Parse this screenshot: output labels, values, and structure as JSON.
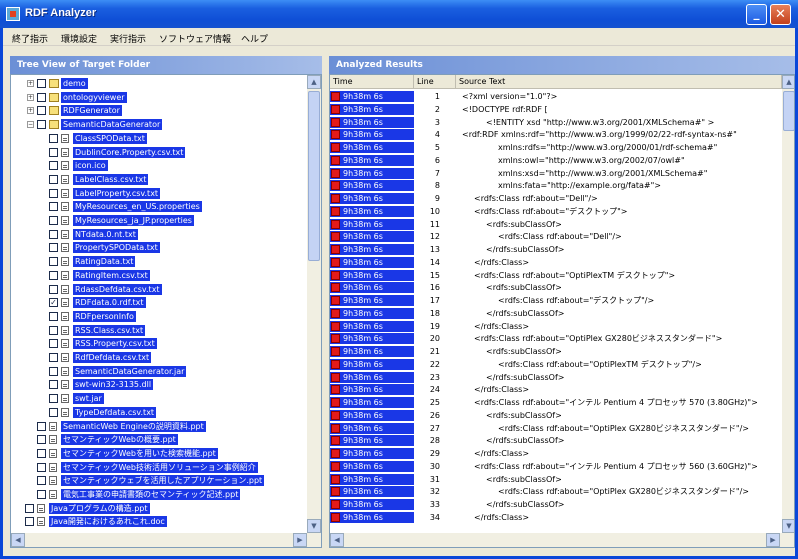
{
  "window": {
    "title": "RDF Analyzer",
    "minimize_label": "_",
    "close_label": "✕"
  },
  "menu": [
    {
      "label": "終了指示"
    },
    {
      "label": "環境設定"
    },
    {
      "label": "実行指示"
    },
    {
      "label": "ソフトウェア情報"
    },
    {
      "label": "ヘルプ"
    }
  ],
  "tree_panel": {
    "title": "Tree View of Target Folder",
    "items": [
      {
        "label": "demo",
        "depth": 2,
        "kind": "folder",
        "expanded": false,
        "checked": false
      },
      {
        "label": "ontologyviewer",
        "depth": 2,
        "kind": "folder",
        "expanded": false,
        "checked": false
      },
      {
        "label": "RDFGenerator",
        "depth": 2,
        "kind": "folder",
        "expanded": false,
        "checked": false
      },
      {
        "label": "SemanticDataGenerator",
        "depth": 2,
        "kind": "folder",
        "expanded": true,
        "checked": false
      },
      {
        "label": "ClassSPOData.txt",
        "depth": 3,
        "kind": "file",
        "checked": false
      },
      {
        "label": "DublinCore.Property.csv.txt",
        "depth": 3,
        "kind": "file",
        "checked": false
      },
      {
        "label": "icon.ico",
        "depth": 3,
        "kind": "file",
        "checked": false
      },
      {
        "label": "LabelClass.csv.txt",
        "depth": 3,
        "kind": "file",
        "checked": false
      },
      {
        "label": "LabelProperty.csv.txt",
        "depth": 3,
        "kind": "file",
        "checked": false
      },
      {
        "label": "MyResources_en_US.properties",
        "depth": 3,
        "kind": "file",
        "checked": false
      },
      {
        "label": "MyResources_ja_JP.properties",
        "depth": 3,
        "kind": "file",
        "checked": false
      },
      {
        "label": "NTdata.0.nt.txt",
        "depth": 3,
        "kind": "file",
        "checked": false
      },
      {
        "label": "PropertySPOData.txt",
        "depth": 3,
        "kind": "file",
        "checked": false
      },
      {
        "label": "RatingData.txt",
        "depth": 3,
        "kind": "file",
        "checked": false
      },
      {
        "label": "RatingItem.csv.txt",
        "depth": 3,
        "kind": "file",
        "checked": false
      },
      {
        "label": "RdassDefdata.csv.txt",
        "depth": 3,
        "kind": "file",
        "checked": false
      },
      {
        "label": "RDFdata.0.rdf.txt",
        "depth": 3,
        "kind": "file",
        "checked": true
      },
      {
        "label": "RDFpersonInfo",
        "depth": 3,
        "kind": "file",
        "checked": false
      },
      {
        "label": "RSS.Class.csv.txt",
        "depth": 3,
        "kind": "file",
        "checked": false
      },
      {
        "label": "RSS.Property.csv.txt",
        "depth": 3,
        "kind": "file",
        "checked": false
      },
      {
        "label": "RdfDefdata.csv.txt",
        "depth": 3,
        "kind": "file",
        "checked": false
      },
      {
        "label": "SemanticDataGenerator.jar",
        "depth": 3,
        "kind": "file",
        "checked": false
      },
      {
        "label": "swt-win32-3135.dll",
        "depth": 3,
        "kind": "file",
        "checked": false
      },
      {
        "label": "swt.jar",
        "depth": 3,
        "kind": "file",
        "checked": false
      },
      {
        "label": "TypeDefdata.csv.txt",
        "depth": 3,
        "kind": "file",
        "checked": false
      },
      {
        "label": "SemanticWeb Engineの説明資料.ppt",
        "depth": 2,
        "kind": "file",
        "checked": false
      },
      {
        "label": "セマンティックWebの概要.ppt",
        "depth": 2,
        "kind": "file",
        "checked": false
      },
      {
        "label": "セマンティックWebを用いた検索機能.ppt",
        "depth": 2,
        "kind": "file",
        "checked": false
      },
      {
        "label": "セマンティックWeb技術活用ソリューション事例紹介",
        "depth": 2,
        "kind": "file",
        "checked": false
      },
      {
        "label": "セマンティックウェブを活用したアプリケーション.ppt",
        "depth": 2,
        "kind": "file",
        "checked": false
      },
      {
        "label": "電気工事業の申請書類のセマンティック記述.ppt",
        "depth": 2,
        "kind": "file",
        "checked": false
      },
      {
        "label": "Javaプログラムの構造.ppt",
        "depth": 1,
        "kind": "file",
        "checked": false
      },
      {
        "label": "Java開発におけるあれこれ.doc",
        "depth": 1,
        "kind": "file",
        "checked": false
      }
    ]
  },
  "results_panel": {
    "title": "Analyzed Results",
    "columns": [
      "Time",
      "Line",
      "Source Text"
    ],
    "rows": [
      {
        "time": "9h38m 6s",
        "line": "1",
        "indent": 0,
        "text": "<?xml version=\"1.0\"?>"
      },
      {
        "time": "9h38m 6s",
        "line": "2",
        "indent": 0,
        "text": "<!DOCTYPE rdf:RDF ["
      },
      {
        "time": "9h38m 6s",
        "line": "3",
        "indent": 2,
        "text": "<!ENTITY xsd \"http://www.w3.org/2001/XMLSchema#\" >"
      },
      {
        "time": "9h38m 6s",
        "line": "4",
        "indent": 0,
        "text": "<rdf:RDF xmlns:rdf=\"http://www.w3.org/1999/02/22-rdf-syntax-ns#\""
      },
      {
        "time": "9h38m 6s",
        "line": "5",
        "indent": 3,
        "text": "xmlns:rdfs=\"http://www.w3.org/2000/01/rdf-schema#\""
      },
      {
        "time": "9h38m 6s",
        "line": "6",
        "indent": 3,
        "text": "xmlns:owl=\"http://www.w3.org/2002/07/owl#\""
      },
      {
        "time": "9h38m 6s",
        "line": "7",
        "indent": 3,
        "text": "xmlns:xsd=\"http://www.w3.org/2001/XMLSchema#\""
      },
      {
        "time": "9h38m 6s",
        "line": "8",
        "indent": 3,
        "text": "xmlns:fata=\"http://example.org/fata#\">"
      },
      {
        "time": "9h38m 6s",
        "line": "9",
        "indent": 1,
        "text": "<rdfs:Class rdf:about=\"Dell\"/>"
      },
      {
        "time": "9h38m 6s",
        "line": "10",
        "indent": 1,
        "text": "<rdfs:Class rdf:about=\"デスクトップ\">"
      },
      {
        "time": "9h38m 6s",
        "line": "11",
        "indent": 2,
        "text": "<rdfs:subClassOf>"
      },
      {
        "time": "9h38m 6s",
        "line": "12",
        "indent": 3,
        "text": "<rdfs:Class rdf:about=\"Dell\"/>"
      },
      {
        "time": "9h38m 6s",
        "line": "13",
        "indent": 2,
        "text": "</rdfs:subClassOf>"
      },
      {
        "time": "9h38m 6s",
        "line": "14",
        "indent": 1,
        "text": "</rdfs:Class>"
      },
      {
        "time": "9h38m 6s",
        "line": "15",
        "indent": 1,
        "text": "<rdfs:Class rdf:about=\"OptiPlexTM デスクトップ\">"
      },
      {
        "time": "9h38m 6s",
        "line": "16",
        "indent": 2,
        "text": "<rdfs:subClassOf>"
      },
      {
        "time": "9h38m 6s",
        "line": "17",
        "indent": 3,
        "text": "<rdfs:Class rdf:about=\"デスクトップ\"/>"
      },
      {
        "time": "9h38m 6s",
        "line": "18",
        "indent": 2,
        "text": "</rdfs:subClassOf>"
      },
      {
        "time": "9h38m 6s",
        "line": "19",
        "indent": 1,
        "text": "</rdfs:Class>"
      },
      {
        "time": "9h38m 6s",
        "line": "20",
        "indent": 1,
        "text": "<rdfs:Class rdf:about=\"OptiPlex GX280ビジネススタンダード\">"
      },
      {
        "time": "9h38m 6s",
        "line": "21",
        "indent": 2,
        "text": "<rdfs:subClassOf>"
      },
      {
        "time": "9h38m 6s",
        "line": "22",
        "indent": 3,
        "text": "<rdfs:Class rdf:about=\"OptiPlexTM デスクトップ\"/>"
      },
      {
        "time": "9h38m 6s",
        "line": "23",
        "indent": 2,
        "text": "</rdfs:subClassOf>"
      },
      {
        "time": "9h38m 6s",
        "line": "24",
        "indent": 1,
        "text": "</rdfs:Class>"
      },
      {
        "time": "9h38m 6s",
        "line": "25",
        "indent": 1,
        "text": "<rdfs:Class rdf:about=\"インテル Pentium 4 プロセッサ 570 (3.80GHz)\">"
      },
      {
        "time": "9h38m 6s",
        "line": "26",
        "indent": 2,
        "text": "<rdfs:subClassOf>"
      },
      {
        "time": "9h38m 6s",
        "line": "27",
        "indent": 3,
        "text": "<rdfs:Class rdf:about=\"OptiPlex GX280ビジネススタンダード\"/>"
      },
      {
        "time": "9h38m 6s",
        "line": "28",
        "indent": 2,
        "text": "</rdfs:subClassOf>"
      },
      {
        "time": "9h38m 6s",
        "line": "29",
        "indent": 1,
        "text": "</rdfs:Class>"
      },
      {
        "time": "9h38m 6s",
        "line": "30",
        "indent": 1,
        "text": "<rdfs:Class rdf:about=\"インテル Pentium 4 プロセッサ 560 (3.60GHz)\">"
      },
      {
        "time": "9h38m 6s",
        "line": "31",
        "indent": 2,
        "text": "<rdfs:subClassOf>"
      },
      {
        "time": "9h38m 6s",
        "line": "32",
        "indent": 3,
        "text": "<rdfs:Class rdf:about=\"OptiPlex GX280ビジネススタンダード\"/>"
      },
      {
        "time": "9h38m 6s",
        "line": "33",
        "indent": 2,
        "text": "</rdfs:subClassOf>"
      },
      {
        "time": "9h38m 6s",
        "line": "34",
        "indent": 1,
        "text": "</rdfs:Class>"
      }
    ]
  },
  "colors": {
    "title_bar": "#1a5fe0",
    "selection": "#1a37e6",
    "row_flag": "#e21a1a",
    "pane_header": "#6b8fd6"
  },
  "icons": {
    "expand": "plus-icon",
    "collapse": "minus-icon",
    "folder": "folder-icon",
    "file": "file-icon",
    "flag": "flag-icon"
  }
}
